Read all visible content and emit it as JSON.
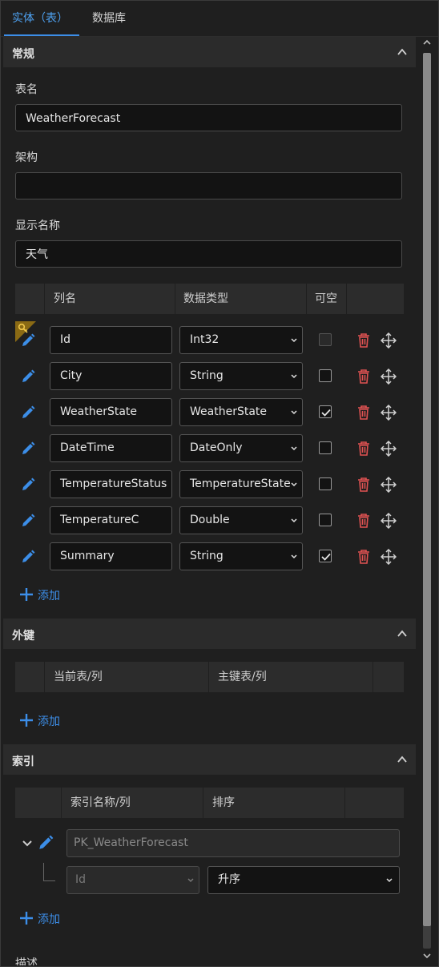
{
  "tabs": [
    {
      "label": "实体（表）",
      "active": true
    },
    {
      "label": "数据库",
      "active": false
    }
  ],
  "general": {
    "title": "常规",
    "table_name_label": "表名",
    "table_name_value": "WeatherForecast",
    "schema_label": "架构",
    "schema_value": "",
    "display_name_label": "显示名称",
    "display_name_value": "天气"
  },
  "columns": {
    "headers": {
      "name": "列名",
      "type": "数据类型",
      "nullable": "可空"
    },
    "rows": [
      {
        "name": "Id",
        "type": "Int32",
        "nullable": false,
        "primary_key": true
      },
      {
        "name": "City",
        "type": "String",
        "nullable": false,
        "primary_key": false
      },
      {
        "name": "WeatherState",
        "type": "WeatherState",
        "nullable": true,
        "primary_key": false
      },
      {
        "name": "DateTime",
        "type": "DateOnly",
        "nullable": false,
        "primary_key": false
      },
      {
        "name": "TemperatureStatus",
        "type": "TemperatureState",
        "nullable": false,
        "primary_key": false
      },
      {
        "name": "TemperatureC",
        "type": "Double",
        "nullable": false,
        "primary_key": false
      },
      {
        "name": "Summary",
        "type": "String",
        "nullable": true,
        "primary_key": false
      }
    ],
    "add_label": "添加"
  },
  "foreign_keys": {
    "title": "外键",
    "headers": {
      "current": "当前表/列",
      "principal": "主键表/列"
    },
    "add_label": "添加"
  },
  "indexes": {
    "title": "索引",
    "headers": {
      "name": "索引名称/列",
      "order": "排序"
    },
    "index_name": "PK_WeatherForecast",
    "column_value": "Id",
    "order_value": "升序",
    "add_label": "添加"
  },
  "description_label": "描述",
  "colors": {
    "accent": "#3c8ee8",
    "danger": "#e05252",
    "key": "#d4a017"
  }
}
